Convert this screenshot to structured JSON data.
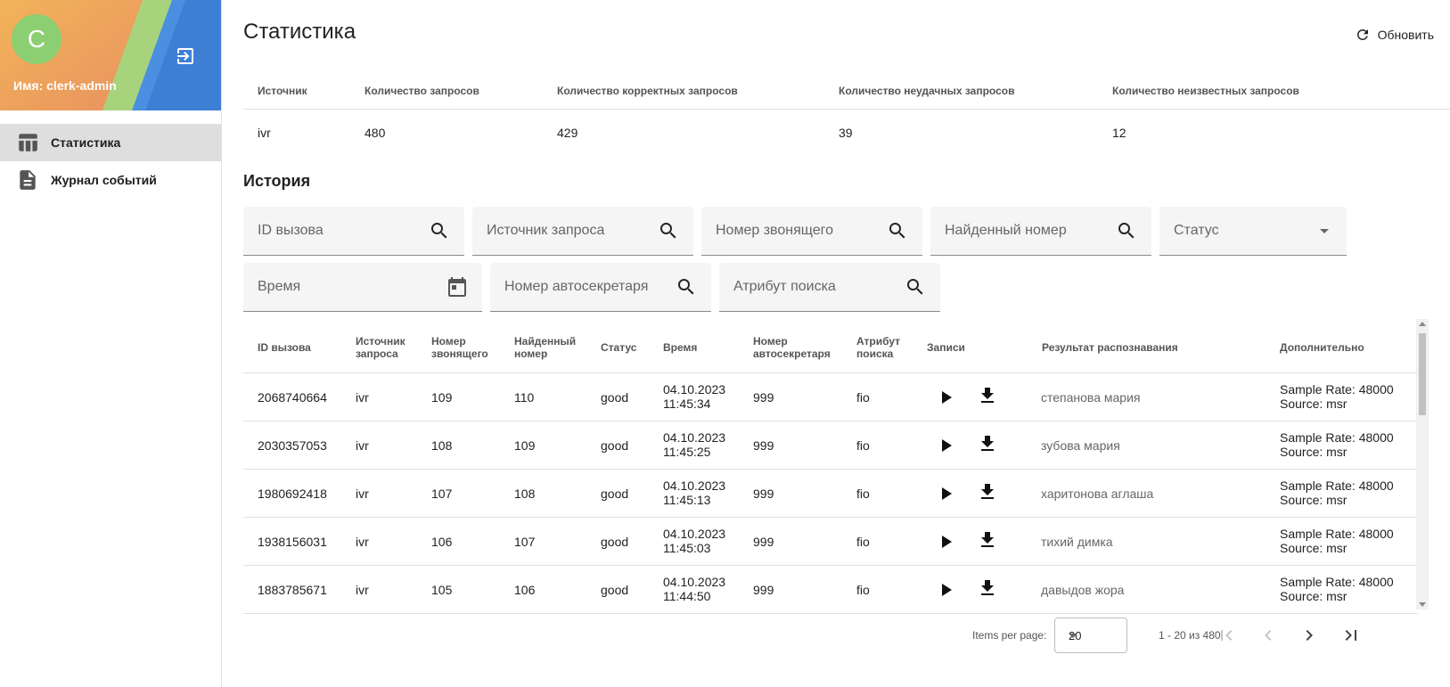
{
  "sidebar": {
    "avatar_letter": "С",
    "user_label": "Имя: clerk-admin",
    "items": [
      {
        "label": "Статистика",
        "icon": "table-icon"
      },
      {
        "label": "Журнал событий",
        "icon": "document-icon"
      }
    ]
  },
  "header": {
    "title": "Статистика",
    "refresh_label": "Обновить"
  },
  "stats": {
    "headers": [
      "Источник",
      "Количество запросов",
      "Количество корректных запросов",
      "Количество неудачных запросов",
      "Количество неизвестных запросов"
    ],
    "row": [
      "ivr",
      "480",
      "429",
      "39",
      "12"
    ]
  },
  "history": {
    "title": "История",
    "filters": {
      "call_id": "ID вызова",
      "source": "Источник запроса",
      "caller": "Номер звонящего",
      "found": "Найденный номер",
      "status": "Статус",
      "time": "Время",
      "autosec": "Номер автосекретаря",
      "attr": "Атрибут поиска"
    },
    "columns": {
      "call_id": "ID вызова",
      "source": [
        "Источник",
        "запроса"
      ],
      "caller": [
        "Номер",
        "звонящего"
      ],
      "found": [
        "Найденный",
        "номер"
      ],
      "status": "Статус",
      "time": "Время",
      "autosec": [
        "Номер",
        "автосекретаря"
      ],
      "attr": [
        "Атрибут",
        "поиска"
      ],
      "records": "Записи",
      "result": "Результат распознавания",
      "extra": "Дополнительно"
    },
    "rows": [
      {
        "id": "2068740664",
        "source": "ivr",
        "caller": "109",
        "found": "110",
        "status": "good",
        "date": "04.10.2023",
        "time": "11:45:34",
        "autosec": "999",
        "attr": "fio",
        "result": "степанова мария",
        "extra1": "Sample Rate: 48000",
        "extra2": "Source: msr"
      },
      {
        "id": "2030357053",
        "source": "ivr",
        "caller": "108",
        "found": "109",
        "status": "good",
        "date": "04.10.2023",
        "time": "11:45:25",
        "autosec": "999",
        "attr": "fio",
        "result": "зубова мария",
        "extra1": "Sample Rate: 48000",
        "extra2": "Source: msr"
      },
      {
        "id": "1980692418",
        "source": "ivr",
        "caller": "107",
        "found": "108",
        "status": "good",
        "date": "04.10.2023",
        "time": "11:45:13",
        "autosec": "999",
        "attr": "fio",
        "result": "харитонова аглаша",
        "extra1": "Sample Rate: 48000",
        "extra2": "Source: msr"
      },
      {
        "id": "1938156031",
        "source": "ivr",
        "caller": "106",
        "found": "107",
        "status": "good",
        "date": "04.10.2023",
        "time": "11:45:03",
        "autosec": "999",
        "attr": "fio",
        "result": "тихий димка",
        "extra1": "Sample Rate: 48000",
        "extra2": "Source: msr"
      },
      {
        "id": "1883785671",
        "source": "ivr",
        "caller": "105",
        "found": "106",
        "status": "good",
        "date": "04.10.2023",
        "time": "11:44:50",
        "autosec": "999",
        "attr": "fio",
        "result": "давыдов жора",
        "extra1": "Sample Rate: 48000",
        "extra2": "Source: msr"
      }
    ]
  },
  "paginator": {
    "items_per_page_label": "Items per page:",
    "page_size": "20",
    "range": "1 - 20 из 480"
  },
  "colors": {
    "avatar": "#8ccf73",
    "banner_blue": "#4a90e2",
    "banner_orange": "#f0a35e",
    "banner_green": "#9dd07a"
  }
}
